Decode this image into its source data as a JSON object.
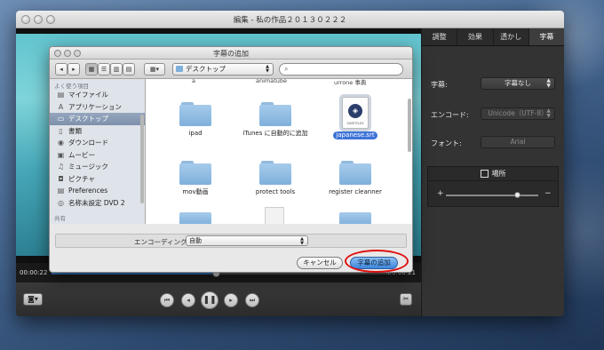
{
  "window": {
    "title": "編集 - 私の作品２０１３０２２２"
  },
  "tabs": [
    {
      "label": "調整"
    },
    {
      "label": "効果"
    },
    {
      "label": "透かし"
    },
    {
      "label": "字幕"
    }
  ],
  "subtitle_panel": {
    "subtitle_label": "字幕:",
    "subtitle_value": "字幕なし",
    "encode_label": "エンコード:",
    "encode_value": "Unicode（UTF-8）",
    "font_label": "フォント:",
    "font_value": "Arial",
    "position_label": "場所",
    "plus": "+",
    "minus": "−"
  },
  "timeline": {
    "current": "00:00:22",
    "remaining": "-00:00:21"
  },
  "dialog": {
    "title": "字幕の追加",
    "location": "デスクトップ",
    "sidebar_section_favorites": "よく使う項目",
    "sidebar_section_shared": "共有",
    "sidebar_items": [
      {
        "label": "マイファイル",
        "icon": "▤"
      },
      {
        "label": "アプリケーション",
        "icon": "A"
      },
      {
        "label": "デスクトップ",
        "icon": "▭"
      },
      {
        "label": "書類",
        "icon": "▯"
      },
      {
        "label": "ダウンロード",
        "icon": "◉"
      },
      {
        "label": "ムービー",
        "icon": "▣"
      },
      {
        "label": "ミュージック",
        "icon": "♫"
      },
      {
        "label": "ピクチャ",
        "icon": "◘"
      },
      {
        "label": "Preferences",
        "icon": "▤"
      },
      {
        "label": "名称未設定 DVD 2",
        "icon": "◎"
      }
    ],
    "files_top_partial": [
      "a",
      "animatube",
      "urrone 事典"
    ],
    "files": [
      {
        "name": "ipad",
        "type": "folder"
      },
      {
        "name": "iTunes に自動的に追加",
        "type": "folder"
      },
      {
        "name": "japanese.srt",
        "type": "document",
        "selected": true,
        "tag": "SUBTITLES"
      },
      {
        "name": "mov動画",
        "type": "folder"
      },
      {
        "name": "protect tools",
        "type": "folder"
      },
      {
        "name": "register cleanner",
        "type": "folder"
      }
    ],
    "encoding_label": "エンコーディング:",
    "encoding_value": "自動",
    "cancel_label": "キャンセル",
    "add_label": "字幕の追加"
  },
  "colors": {
    "selection": "#3f74d8",
    "highlight_ring": "#e01010",
    "panel_bg": "#333333"
  }
}
